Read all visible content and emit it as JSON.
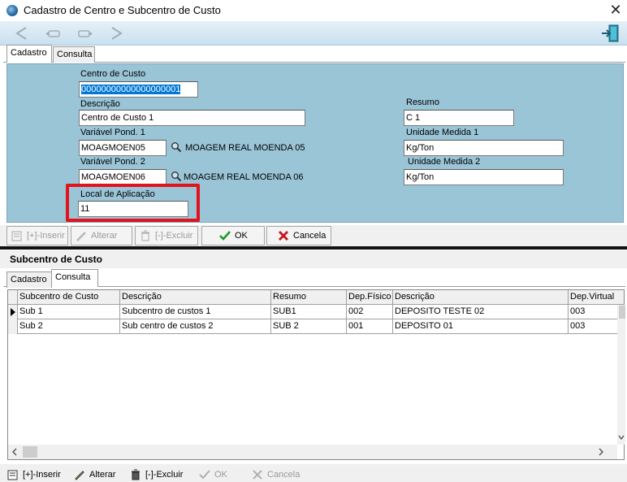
{
  "window": {
    "title": "Cadastro de Centro e Subcentro de Custo",
    "close_glyph": "✕"
  },
  "toolbar": {
    "icons": [
      "arrow-left-icon",
      "hand-left-icon",
      "hand-right-icon",
      "arrow-right-icon",
      "exit-door-icon"
    ]
  },
  "top_tabs": [
    {
      "label": "Cadastro",
      "active": true
    },
    {
      "label": "Consulta",
      "active": false
    }
  ],
  "form": {
    "centro_de_custo": {
      "label": "Centro de Custo",
      "value": "00000000000000000001"
    },
    "descricao": {
      "label": "Descrição",
      "value": "Centro de Custo 1"
    },
    "resumo": {
      "label": "Resumo",
      "value": "C 1"
    },
    "variavel_pond_1": {
      "label": "Variável Pond. 1",
      "value": "MOAGMOEN05",
      "description": "MOAGEM REAL MOENDA 05"
    },
    "unidade_medida_1": {
      "label": "Unidade Medida 1",
      "value": "Kg/Ton"
    },
    "variavel_pond_2": {
      "label": "Variável Pond. 2",
      "value": "MOAGMOEN06",
      "description": "MOAGEM REAL MOENDA 06"
    },
    "unidade_medida_2": {
      "label": "Unidade Medida 2",
      "value": "Kg/Ton"
    },
    "local_de_aplicacao": {
      "label": "Local de Aplicação",
      "value": "11"
    }
  },
  "action_bar_top": {
    "inserir": "[+]-Inserir",
    "alterar": "Alterar",
    "excluir": "[-]-Excluir",
    "ok": "OK",
    "cancela": "Cancela"
  },
  "subcentro": {
    "title": "Subcentro de Custo",
    "tabs": [
      {
        "label": "Cadastro",
        "active": false
      },
      {
        "label": "Consulta",
        "active": true
      }
    ],
    "columns": [
      "Subcentro de Custo",
      "Descrição",
      "Resumo",
      "Dep.Físico",
      "Descrição",
      "Dep.Virtual"
    ],
    "rows": [
      [
        "Sub 1",
        "Subcentro de custos 1",
        "SUB1",
        "002",
        "DEPOSITO TESTE 02",
        "003"
      ],
      [
        "Sub 2",
        "Sub centro de custos 2",
        "SUB 2",
        "001",
        "DEPOSITO 01",
        "003"
      ]
    ]
  },
  "action_bar_bottom": {
    "inserir": "[+]-Inserir",
    "alterar": "Alterar",
    "excluir": "[-]-Excluir",
    "ok": "OK",
    "cancela": "Cancela"
  },
  "colors": {
    "form_background": "#9ac5d7",
    "highlight_border": "#e1131c",
    "selection": "#0078d7",
    "ok_green": "#1f9a2a",
    "cancel_red": "#c8141c"
  }
}
